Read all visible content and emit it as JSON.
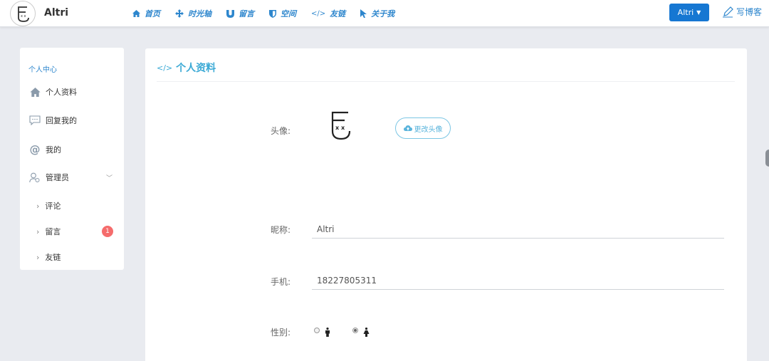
{
  "app": {
    "brand": "Altri"
  },
  "nav": {
    "items": [
      {
        "label": "首页",
        "icon": "home-icon"
      },
      {
        "label": "时光轴",
        "icon": "move-arrows-icon"
      },
      {
        "label": "留言",
        "icon": "magnet-icon"
      },
      {
        "label": "空间",
        "icon": "shield-icon"
      },
      {
        "label": "友链",
        "icon": "code-icon"
      },
      {
        "label": "关于我",
        "icon": "cursor-icon"
      }
    ]
  },
  "user_menu": {
    "label": "Altri"
  },
  "write": {
    "label": "写博客",
    "icon": "pen-icon"
  },
  "sidebar": {
    "title": "个人中心",
    "items": [
      {
        "label": "个人资料",
        "icon": "home-icon"
      },
      {
        "label": "回复我的",
        "icon": "comment-icon"
      },
      {
        "label": "我的",
        "icon": "at-icon"
      },
      {
        "label": "管理员",
        "icon": "users-icon"
      }
    ],
    "sub_items": [
      {
        "label": "评论"
      },
      {
        "label": "留言",
        "badge": "1"
      },
      {
        "label": "友链"
      }
    ]
  },
  "main": {
    "title": "个人资料",
    "avatar_label": "头像:",
    "change_avatar_label": "更改头像",
    "nickname_label": "昵称:",
    "nickname_value": "Altri",
    "phone_label": "手机:",
    "phone_value": "18227805311",
    "gender_label": "性别:",
    "gender_selected": "female"
  },
  "colors": {
    "accent": "#2d86cd",
    "button": "#1677d2",
    "title": "#3aa9d5",
    "badge": "#f56c6c"
  }
}
